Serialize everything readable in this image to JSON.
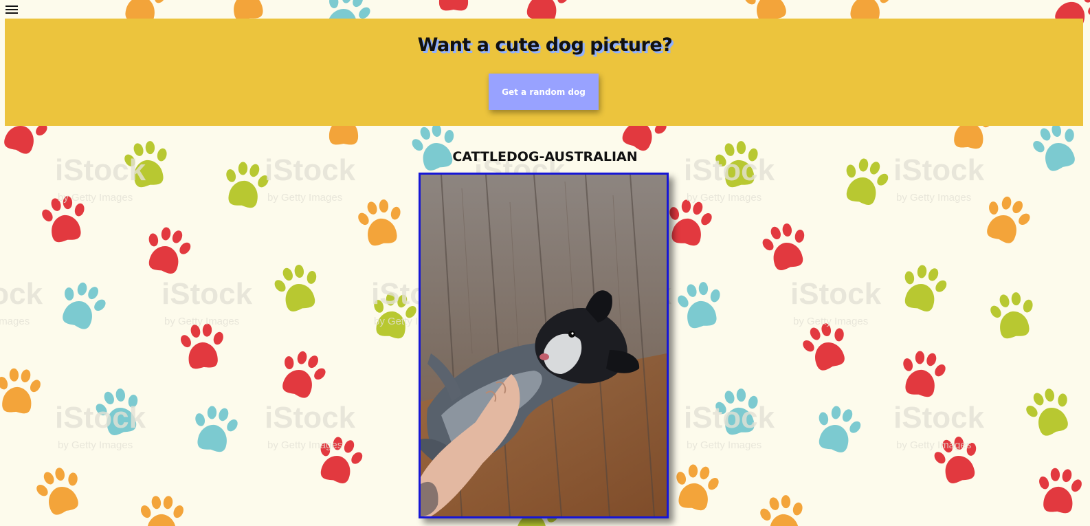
{
  "header": {
    "title": "Want a cute dog picture?",
    "button_label": "Get a random dog",
    "menu_icon": "hamburger-menu-icon"
  },
  "dog": {
    "breed": "CATTLEDOG-AUSTRALIAN",
    "image_icon": "dog-photo"
  },
  "background": {
    "pattern": "paw-prints",
    "watermark_text": "iStock",
    "watermark_subtext": "by Getty Images"
  },
  "colors": {
    "page_background": "#fdfbec",
    "header_background": "#ecc43d",
    "button_background": "#98a2ff",
    "image_border": "#1616d6",
    "paw_red": "#e2393f",
    "paw_orange": "#f3a43a",
    "paw_green": "#b8c831",
    "paw_teal": "#7ccad0"
  }
}
